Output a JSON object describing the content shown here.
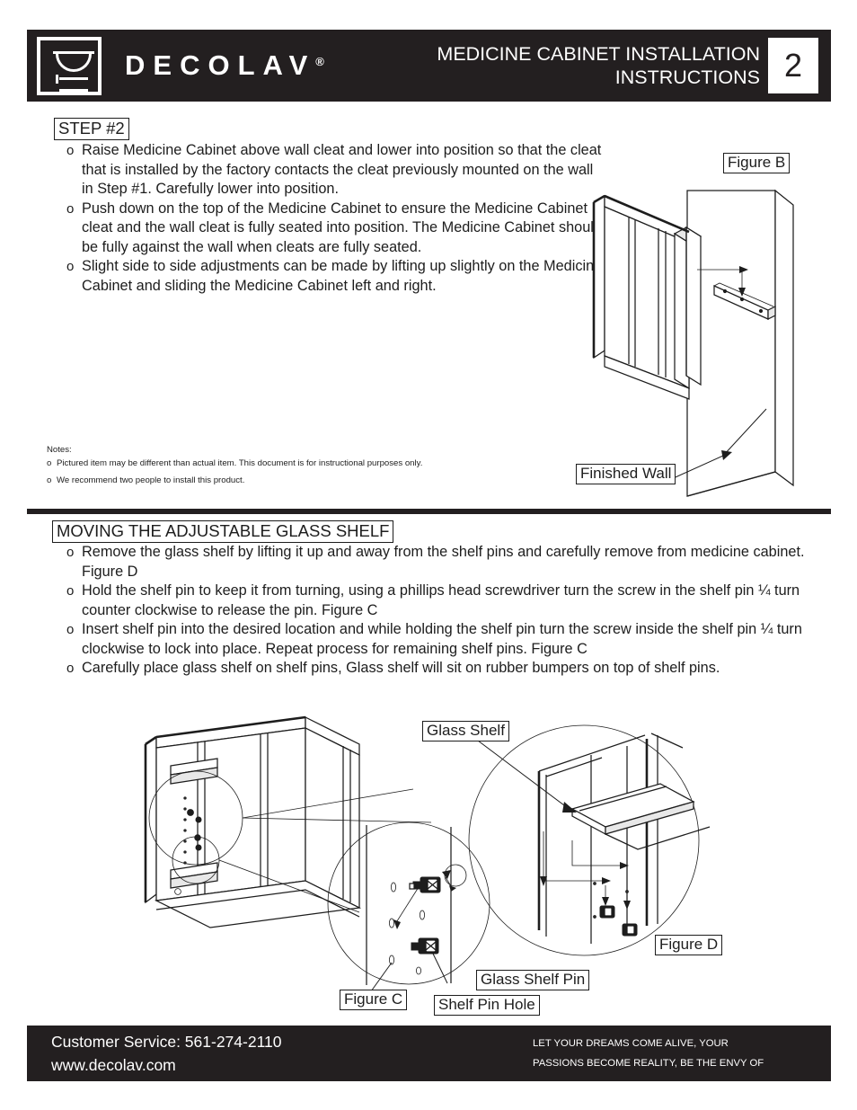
{
  "brand": {
    "wordmark": "DECOLAV",
    "registered_mark": "®",
    "logo_icon": "sink-basin-logo-icon"
  },
  "header": {
    "title_line1": "MEDICINE CABINET INSTALLATION",
    "title_line2": "INSTRUCTIONS",
    "page_number": "2",
    "background_color": "#231f20",
    "text_color": "#ffffff"
  },
  "section1": {
    "label": "STEP #2",
    "bullet_mark": "o",
    "bullets": [
      "Raise Medicine Cabinet above wall cleat and lower into position so that the cleat that is installed by the factory contacts the cleat previously mounted on the wall in Step #1. Carefully lower into position.",
      "Push down on the top of the Medicine Cabinet to ensure the Medicine Cabinet cleat and the wall cleat is fully seated into position. The Medicine Cabinet should be fully against the wall when cleats are fully seated.",
      "Slight side to side adjustments can be made by lifting up slightly on the Medicine Cabinet and sliding the Medicine Cabinet left and right."
    ]
  },
  "notes": {
    "title": "Notes:",
    "bullet_mark": "o",
    "items": [
      "Pictured item may be different than actual item. This document is for instructional purposes only.",
      "We recommend two people to install this product."
    ]
  },
  "section2": {
    "label": "MOVING THE ADJUSTABLE GLASS SHELF",
    "bullet_mark": "o",
    "bullets": [
      "Remove the glass shelf by lifting it up and away from the shelf pins and carefully remove from medicine cabinet. Figure D",
      "Hold the shelf pin to keep it from turning, using a phillips head screwdriver turn the screw in the shelf pin ¼ turn counter clockwise to release the pin. Figure C",
      "Insert shelf pin into the desired location and while holding the shelf pin turn the screw inside the shelf pin ¼ turn clockwise to lock into place. Repeat process for remaining shelf pins. Figure C",
      "Carefully place glass shelf on shelf pins, Glass shelf will sit on rubber bumpers on top of shelf pins."
    ]
  },
  "figure_labels": {
    "figure_b": "Figure B",
    "finished_wall": "Finished Wall",
    "glass_shelf": "Glass Shelf",
    "figure_c": "Figure C",
    "figure_d": "Figure D",
    "glass_shelf_pin": "Glass Shelf Pin",
    "shelf_pin_hole": "Shelf Pin Hole"
  },
  "footer": {
    "customer_service": "Customer Service: 561-274-2110",
    "website": "www.decolav.com",
    "tagline_line1": "LET YOUR DREAMS COME ALIVE, YOUR",
    "tagline_line2": "PASSIONS BECOME REALITY, BE THE ENVY OF",
    "background_color": "#231f20",
    "text_color": "#ffffff"
  }
}
